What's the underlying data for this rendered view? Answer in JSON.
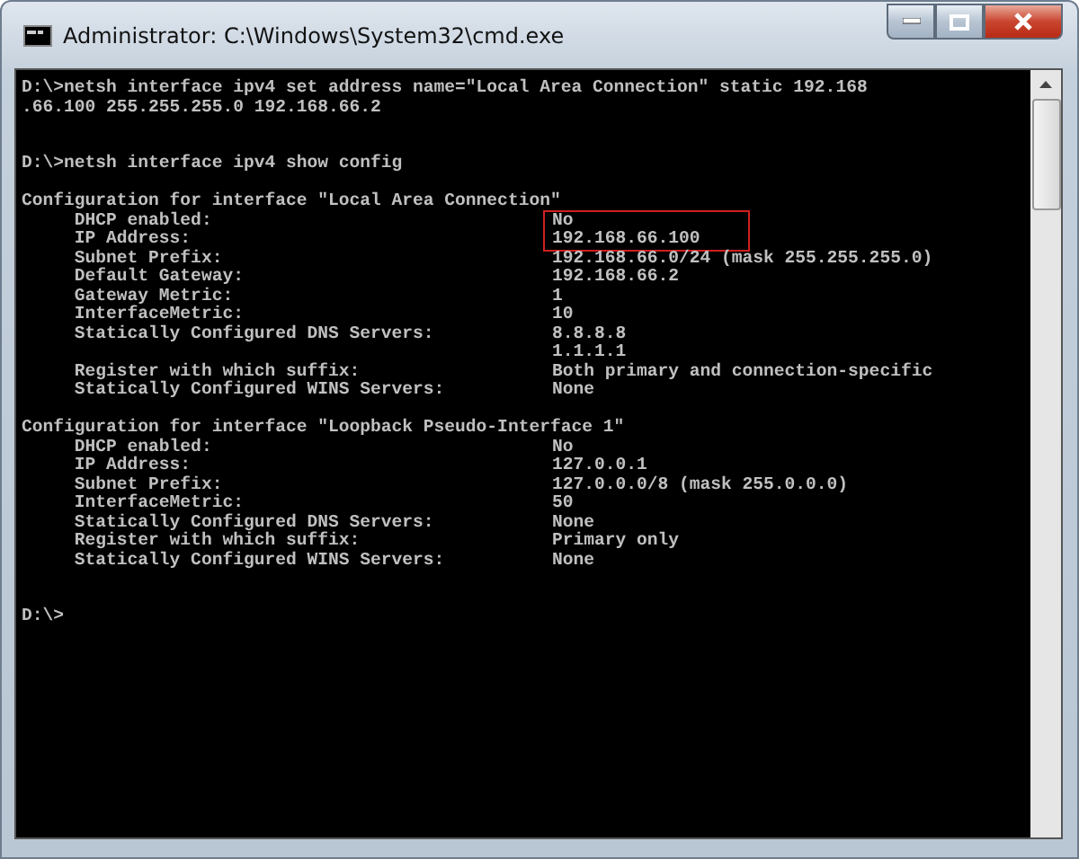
{
  "window": {
    "title": "Administrator: C:\\Windows\\System32\\cmd.exe"
  },
  "console": [
    {
      "kind": "command",
      "lines": [
        "D:\\>netsh interface ipv4 set address name=\"Local Area Connection\" static 192.168",
        ".66.100 255.255.255.0 192.168.66.2"
      ]
    },
    {
      "kind": "command",
      "lines": [
        "D:\\>netsh interface ipv4 show config"
      ]
    },
    {
      "kind": "config",
      "heading": "Configuration for interface \"Local Area Connection\"",
      "entries": [
        {
          "label": "DHCP enabled:",
          "value": "No",
          "highlighted": true
        },
        {
          "label": "IP Address:",
          "value": "192.168.66.100",
          "highlighted": true
        },
        {
          "label": "Subnet Prefix:",
          "value": "192.168.66.0/24 (mask 255.255.255.0)",
          "highlighted": false
        },
        {
          "label": "Default Gateway:",
          "value": "192.168.66.2",
          "highlighted": false
        },
        {
          "label": "Gateway Metric:",
          "value": "1",
          "highlighted": false
        },
        {
          "label": "InterfaceMetric:",
          "value": "10",
          "highlighted": false
        },
        {
          "label": "Statically Configured DNS Servers:",
          "value": "8.8.8.8",
          "highlighted": false
        },
        {
          "value": "1.1.1.1",
          "highlighted": false
        },
        {
          "label": "Register with which suffix:",
          "value": "Both primary and connection-specific",
          "highlighted": false
        },
        {
          "label": "Statically Configured WINS Servers:",
          "value": "None",
          "highlighted": false
        }
      ]
    },
    {
      "kind": "config",
      "heading": "Configuration for interface \"Loopback Pseudo-Interface 1\"",
      "entries": [
        {
          "label": "DHCP enabled:",
          "value": "No",
          "highlighted": false
        },
        {
          "label": "IP Address:",
          "value": "127.0.0.1",
          "highlighted": false
        },
        {
          "label": "Subnet Prefix:",
          "value": "127.0.0.0/8 (mask 255.0.0.0)",
          "highlighted": false
        },
        {
          "label": "InterfaceMetric:",
          "value": "50",
          "highlighted": false
        },
        {
          "label": "Statically Configured DNS Servers:",
          "value": "None",
          "highlighted": false
        },
        {
          "label": "Register with which suffix:",
          "value": "Primary only",
          "highlighted": false
        },
        {
          "label": "Statically Configured WINS Servers:",
          "value": "None",
          "highlighted": false
        }
      ]
    },
    {
      "kind": "prompt",
      "lines": [
        "D:\\>"
      ]
    }
  ]
}
